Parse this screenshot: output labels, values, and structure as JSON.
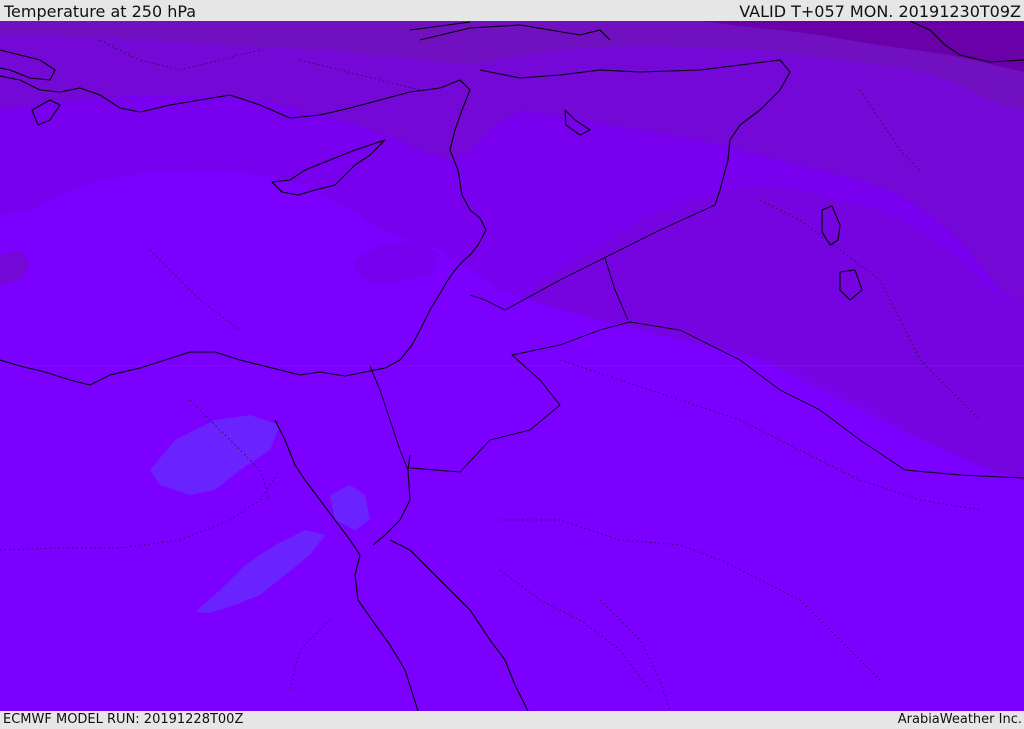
{
  "header": {
    "title": "Temperature at 250 hPa",
    "valid": "VALID T+057 MON. 20191230T09Z"
  },
  "footer": {
    "model_run": "ECMWF MODEL RUN: 20191228T00Z",
    "credit": "ArabiaWeather Inc."
  },
  "colors": {
    "band_warmest": "#7b00ff",
    "band_2": "#7800ee",
    "band_3": "#7408d6",
    "band_4": "#7010c0",
    "band_coldest": "#6a00a8",
    "cool_pocket": "#6a22ff",
    "coastline": "#000000",
    "border": "#1a0a40"
  }
}
